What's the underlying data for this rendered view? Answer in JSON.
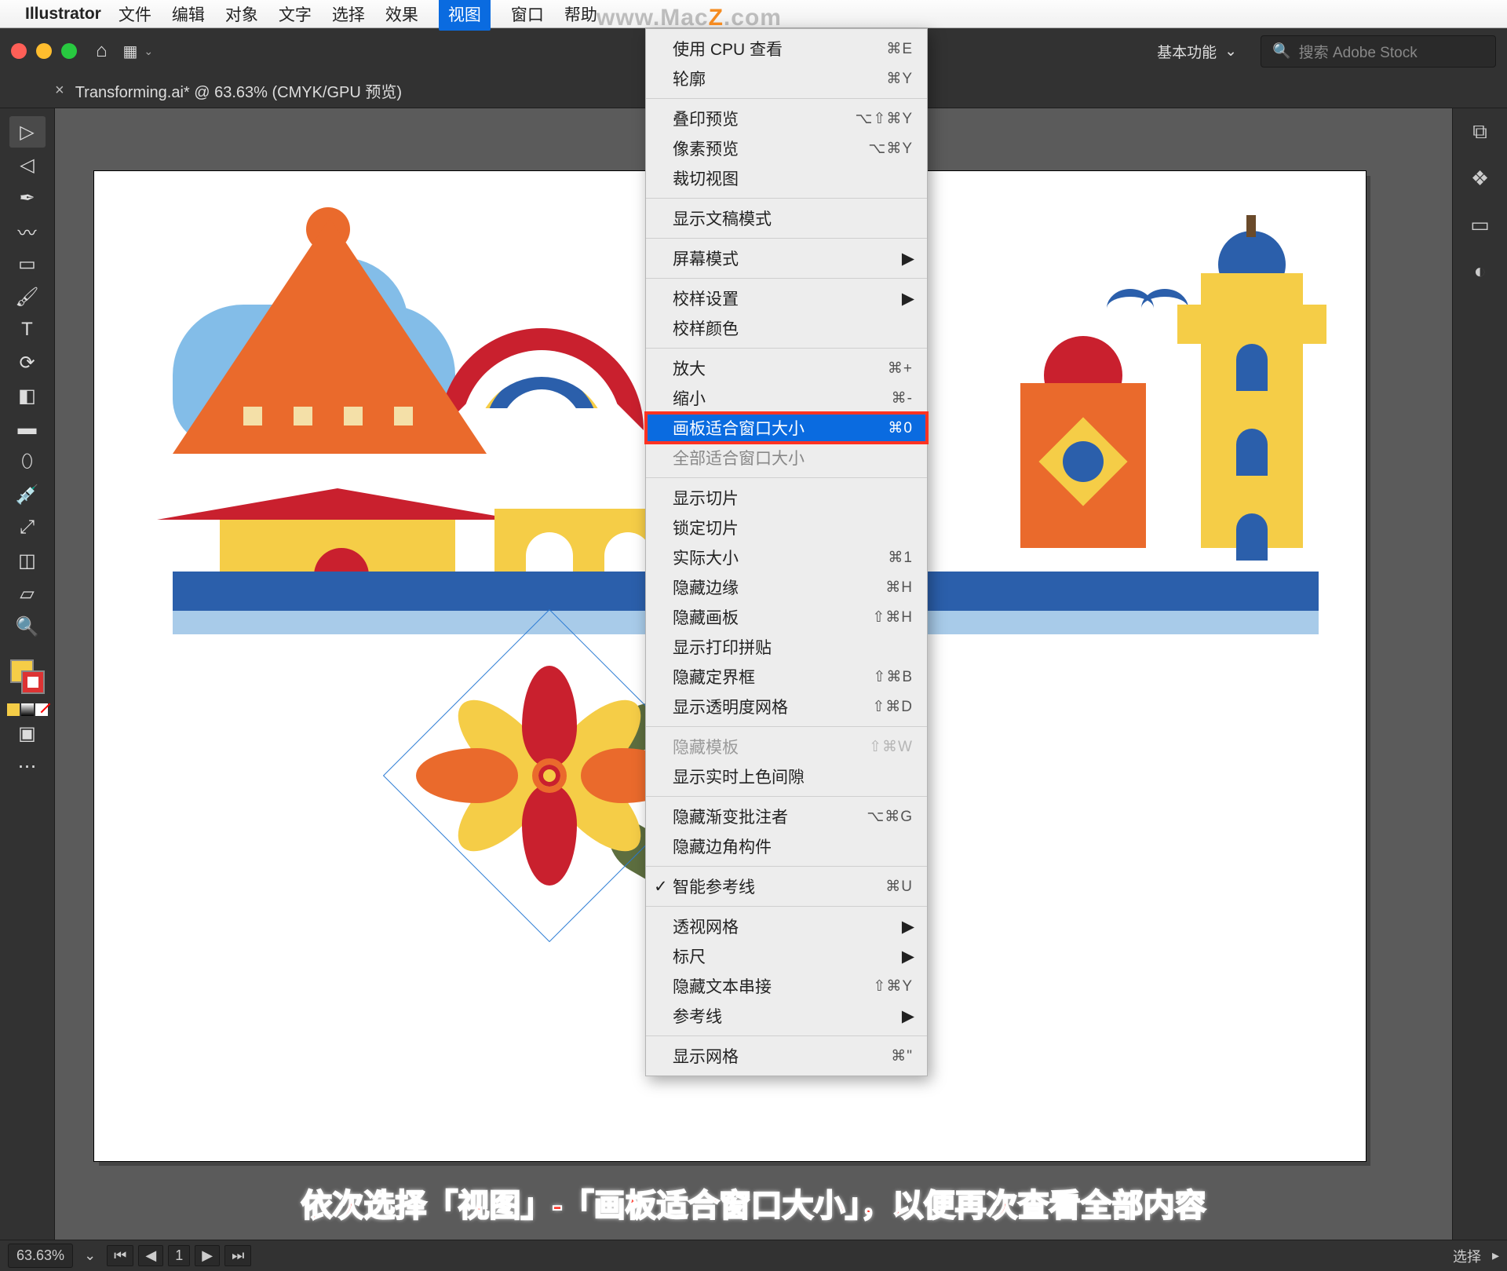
{
  "watermark": {
    "pre": "www.Mac",
    "z": "Z",
    "post": ".com"
  },
  "mac_menu": {
    "app_name": "Illustrator",
    "items": [
      "文件",
      "编辑",
      "对象",
      "文字",
      "选择",
      "效果",
      "视图",
      "窗口",
      "帮助"
    ],
    "active_index": 6
  },
  "topbar": {
    "workspace_label": "基本功能",
    "search_placeholder": "搜索 Adobe Stock"
  },
  "doc_tab": {
    "title": "Transforming.ai* @ 63.63% (CMYK/GPU 预览)"
  },
  "statusbar": {
    "zoom": "63.63%",
    "artboard_num": "1",
    "tool": "选择"
  },
  "caption": "依次选择「视图」-「画板适合窗口大小」，以便再次查看全部内容",
  "dropdown": {
    "highlighted_index": [
      4,
      2
    ],
    "groups": [
      [
        {
          "label": "使用 CPU 查看",
          "shortcut": "⌘E"
        },
        {
          "label": "轮廓",
          "shortcut": "⌘Y"
        }
      ],
      [
        {
          "label": "叠印预览",
          "shortcut": "⌥⇧⌘Y"
        },
        {
          "label": "像素预览",
          "shortcut": "⌥⌘Y"
        },
        {
          "label": "裁切视图",
          "shortcut": ""
        }
      ],
      [
        {
          "label": "显示文稿模式",
          "shortcut": ""
        }
      ],
      [
        {
          "label": "屏幕模式",
          "shortcut": "",
          "submenu": true
        }
      ],
      [
        {
          "label": "校样设置",
          "shortcut": "",
          "submenu": true
        },
        {
          "label": "校样颜色",
          "shortcut": ""
        }
      ],
      [
        {
          "label": "放大",
          "shortcut": "⌘+"
        },
        {
          "label": "缩小",
          "shortcut": "⌘-"
        },
        {
          "label": "画板适合窗口大小",
          "shortcut": "⌘0",
          "highlight": true
        },
        {
          "label": "全部适合窗口大小",
          "shortcut": "",
          "dimmed": true
        }
      ],
      [
        {
          "label": "显示切片",
          "shortcut": ""
        },
        {
          "label": "锁定切片",
          "shortcut": ""
        },
        {
          "label": "实际大小",
          "shortcut": "⌘1"
        },
        {
          "label": "隐藏边缘",
          "shortcut": "⌘H"
        },
        {
          "label": "隐藏画板",
          "shortcut": "⇧⌘H"
        },
        {
          "label": "显示打印拼贴",
          "shortcut": ""
        },
        {
          "label": "隐藏定界框",
          "shortcut": "⇧⌘B"
        },
        {
          "label": "显示透明度网格",
          "shortcut": "⇧⌘D"
        }
      ],
      [
        {
          "label": "隐藏模板",
          "shortcut": "⇧⌘W",
          "disabled": true
        },
        {
          "label": "显示实时上色间隙",
          "shortcut": ""
        }
      ],
      [
        {
          "label": "隐藏渐变批注者",
          "shortcut": "⌥⌘G"
        },
        {
          "label": "隐藏边角构件",
          "shortcut": ""
        }
      ],
      [
        {
          "label": "智能参考线",
          "shortcut": "⌘U",
          "checked": true
        }
      ],
      [
        {
          "label": "透视网格",
          "shortcut": "",
          "submenu": true
        },
        {
          "label": "标尺",
          "shortcut": "",
          "submenu": true
        },
        {
          "label": "隐藏文本串接",
          "shortcut": "⇧⌘Y"
        },
        {
          "label": "参考线",
          "shortcut": "",
          "submenu": true
        }
      ],
      [
        {
          "label": "显示网格",
          "shortcut": "⌘\""
        }
      ]
    ]
  }
}
